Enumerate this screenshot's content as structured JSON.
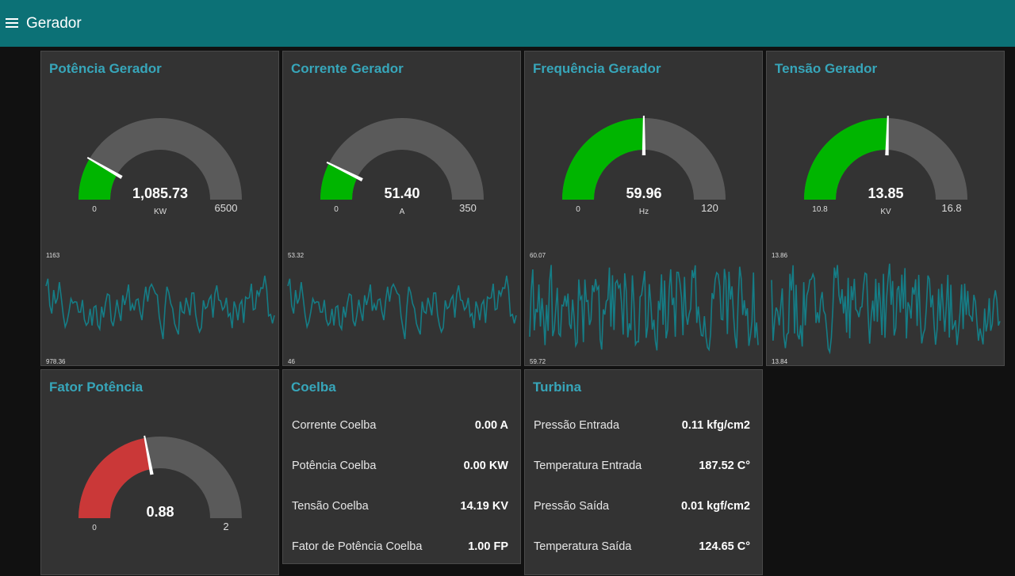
{
  "app": {
    "title": "Gerador"
  },
  "colors": {
    "header": "#0c7176",
    "card": "#333333",
    "title": "#37a6ba",
    "gauge_ok": "#00b500",
    "gauge_pf": "#ca3838",
    "gauge_track": "#5a5a5a",
    "chart_line": "#157d86"
  },
  "cards": {
    "potencia": {
      "title": "Potência Gerador",
      "gauge": {
        "value": 1085.73,
        "display": "1,085.73",
        "min": 0,
        "max": 6500,
        "min_label": "0",
        "max_label": "6500",
        "units": "KW"
      },
      "chart": {
        "ymax_label": "1163",
        "ymin_label": "978.36"
      }
    },
    "corrente": {
      "title": "Corrente Gerador",
      "gauge": {
        "value": 51.4,
        "display": "51.40",
        "min": 0,
        "max": 350,
        "min_label": "0",
        "max_label": "350",
        "units": "A"
      },
      "chart": {
        "ymax_label": "53.32",
        "ymin_label": "46"
      }
    },
    "frequencia": {
      "title": "Frequência Gerador",
      "gauge": {
        "value": 59.96,
        "display": "59.96",
        "min": 0,
        "max": 120,
        "min_label": "0",
        "max_label": "120",
        "units": "Hz"
      },
      "chart": {
        "ymax_label": "60.07",
        "ymin_label": "59.72"
      }
    },
    "tensao": {
      "title": "Tensão Gerador",
      "gauge": {
        "value": 13.85,
        "display": "13.85",
        "min": 10.8,
        "max": 16.8,
        "min_label": "10.8",
        "max_label": "16.8",
        "units": "KV"
      },
      "chart": {
        "ymax_label": "13.86",
        "ymin_label": "13.84"
      }
    },
    "fator": {
      "title": "Fator Potência",
      "gauge": {
        "value": 0.88,
        "display": "0.88",
        "min": 0,
        "max": 2,
        "min_label": "0",
        "max_label": "2",
        "units": ""
      }
    },
    "coelba": {
      "title": "Coelba",
      "rows": [
        {
          "label": "Corrente Coelba",
          "value": "0.00 A"
        },
        {
          "label": "Potência Coelba",
          "value": "0.00 KW"
        },
        {
          "label": "Tensão Coelba",
          "value": "14.19 KV"
        },
        {
          "label": "Fator de Potência Coelba",
          "value": "1.00 FP"
        }
      ]
    },
    "turbina": {
      "title": "Turbina",
      "rows": [
        {
          "label": "Pressão Entrada",
          "value": "0.11 kfg/cm2"
        },
        {
          "label": "Temperatura Entrada",
          "value": "187.52 C°"
        },
        {
          "label": "Pressão Saída",
          "value": "0.01 kgf/cm2"
        },
        {
          "label": "Temperatura Saída",
          "value": "124.65 C°"
        }
      ]
    }
  }
}
